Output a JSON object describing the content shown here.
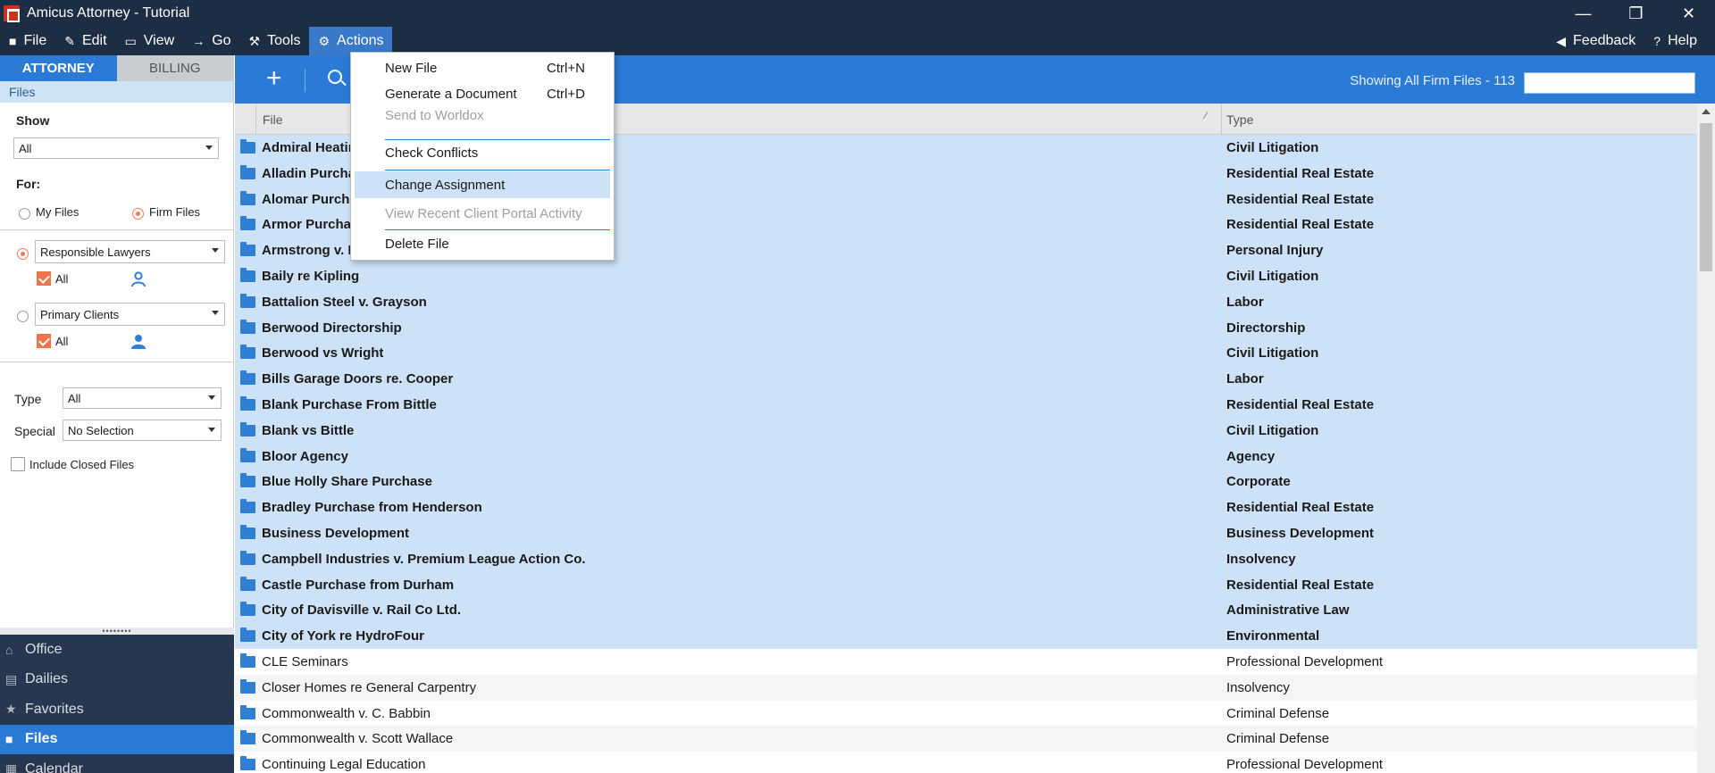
{
  "window": {
    "title": "Amicus Attorney - Tutorial",
    "controls": [
      "—",
      "❐",
      "✕"
    ]
  },
  "menubar": {
    "items": [
      {
        "label": "File",
        "icon": "folder-icon"
      },
      {
        "label": "Edit",
        "icon": "pencil-icon"
      },
      {
        "label": "View",
        "icon": "monitor-icon"
      },
      {
        "label": "Go",
        "icon": "arrow-right-icon"
      },
      {
        "label": "Tools",
        "icon": "wrench-icon"
      },
      {
        "label": "Actions",
        "icon": "gear-icon"
      }
    ],
    "right": [
      {
        "label": "Feedback",
        "icon": "megaphone-icon"
      },
      {
        "label": "Help",
        "icon": "help-icon"
      }
    ]
  },
  "actions_menu": {
    "items": [
      {
        "label": "New File",
        "shortcut": "Ctrl+N",
        "disabled": false
      },
      {
        "label": "Generate a Document",
        "shortcut": "Ctrl+D",
        "disabled": false
      },
      {
        "label": "Send to Worldox",
        "shortcut": "",
        "disabled": true
      },
      {
        "label": "Check Conflicts",
        "shortcut": "",
        "disabled": false
      },
      {
        "label": "Change Assignment",
        "shortcut": "",
        "disabled": false,
        "highlighted": true
      },
      {
        "label": "View Recent Client Portal Activity",
        "shortcut": "",
        "disabled": true
      },
      {
        "label": "Delete File",
        "shortcut": "",
        "disabled": false
      }
    ]
  },
  "left_panel": {
    "tabs": [
      "ATTORNEY",
      "BILLING"
    ],
    "section": "Files",
    "show_label": "Show",
    "show_value": "All",
    "for_label": "For:",
    "my_files": "My Files",
    "firm_files": "Firm Files",
    "lawyers_select": "Responsible Lawyers",
    "lawyers_all": "All",
    "clients_select": "Primary Clients",
    "clients_all": "All",
    "type_label": "Type",
    "type_value": "All",
    "special_label": "Special",
    "special_value": "No Selection",
    "include_closed": "Include Closed Files"
  },
  "bottom_nav": {
    "items": [
      {
        "label": "Office",
        "icon": "home-icon"
      },
      {
        "label": "Dailies",
        "icon": "newspaper-icon"
      },
      {
        "label": "Favorites",
        "icon": "star-icon"
      },
      {
        "label": "Files",
        "icon": "folder-icon",
        "active": true
      },
      {
        "label": "Calendar",
        "icon": "calendar-icon"
      }
    ]
  },
  "toolbar": {
    "showing": "Showing All Firm Files  -  113"
  },
  "grid": {
    "columns": [
      "File",
      "Type"
    ],
    "rows": [
      {
        "file": "Admiral Heating",
        "type": "Civil Litigation",
        "selected": true
      },
      {
        "file": "Alladin Purchase",
        "type": "Residential Real Estate",
        "selected": true
      },
      {
        "file": "Alomar Purchase",
        "type": "Residential Real Estate",
        "selected": true
      },
      {
        "file": "Armor Purchase",
        "type": "Residential Real Estate",
        "selected": true
      },
      {
        "file": "Armstrong v. Lee",
        "type": "Personal Injury",
        "selected": true
      },
      {
        "file": "Baily re Kipling",
        "type": "Civil Litigation",
        "selected": true
      },
      {
        "file": "Battalion Steel v. Grayson",
        "type": "Labor",
        "selected": true
      },
      {
        "file": "Berwood Directorship",
        "type": "Directorship",
        "selected": true
      },
      {
        "file": "Berwood vs Wright",
        "type": "Civil Litigation",
        "selected": true
      },
      {
        "file": "Bills Garage Doors re. Cooper",
        "type": "Labor",
        "selected": true
      },
      {
        "file": "Blank Purchase From Bittle",
        "type": "Residential Real Estate",
        "selected": true
      },
      {
        "file": "Blank vs Bittle",
        "type": "Civil Litigation",
        "selected": true
      },
      {
        "file": "Bloor Agency",
        "type": "Agency",
        "selected": true
      },
      {
        "file": "Blue Holly Share Purchase",
        "type": "Corporate",
        "selected": true
      },
      {
        "file": "Bradley Purchase from Henderson",
        "type": "Residential Real Estate",
        "selected": true
      },
      {
        "file": "Business Development",
        "type": "Business Development",
        "selected": true
      },
      {
        "file": "Campbell Industries v. Premium League Action Co.",
        "type": "Insolvency",
        "selected": true
      },
      {
        "file": "Castle Purchase from Durham",
        "type": "Residential Real Estate",
        "selected": true
      },
      {
        "file": "City of Davisville v. Rail Co Ltd.",
        "type": "Administrative Law",
        "selected": true
      },
      {
        "file": "City of York re HydroFour",
        "type": "Environmental",
        "selected": true
      },
      {
        "file": "CLE Seminars",
        "type": "Professional Development",
        "selected": false
      },
      {
        "file": "Closer Homes re General Carpentry",
        "type": "Insolvency",
        "selected": false
      },
      {
        "file": "Commonwealth v. C. Babbin",
        "type": "Criminal Defense",
        "selected": false
      },
      {
        "file": "Commonwealth v. Scott Wallace",
        "type": "Criminal Defense",
        "selected": false
      },
      {
        "file": "Continuing Legal Education",
        "type": "Professional Development",
        "selected": false
      }
    ]
  }
}
